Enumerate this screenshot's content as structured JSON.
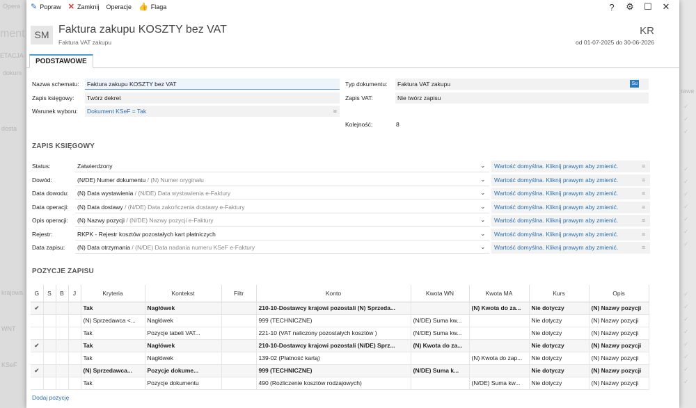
{
  "background": {
    "texts": [
      "Opera",
      "ment",
      "ETACJA",
      "dokum",
      "dosta",
      "krajowa",
      "WNT",
      "KSeF",
      "rawe"
    ]
  },
  "toolbar": {
    "edit_label": "Popraw",
    "close_label": "Zamknij",
    "operations_label": "Operacje",
    "flag_label": "Flaga"
  },
  "header": {
    "avatar": "SM",
    "title": "Faktura zakupu KOSZTY bez VAT",
    "subtitle": "Faktura VAT zakupu",
    "code": "KR",
    "date_range": "od 01-07-2025 do 30-06-2026"
  },
  "tabs": [
    {
      "label": "PODSTAWOWE"
    }
  ],
  "basic": {
    "schema_name_label": "Nazwa schematu:",
    "schema_name_value": "Faktura zakupu KOSZTY bez VAT",
    "ledger_entry_label": "Zapis księgowy:",
    "ledger_entry_value": "Twórz dekret",
    "condition_label": "Warunek wyboru:",
    "condition_value": "Dokument KSeF = Tak",
    "doc_type_label": "Typ dokumentu:",
    "doc_type_value": "Faktura VAT zakupu",
    "doc_type_badge": "Su",
    "vat_entry_label": "Zapis VAT:",
    "vat_entry_value": "Nie twórz zapisu",
    "order_label": "Kolejność:",
    "order_value": "8"
  },
  "sections": {
    "ledger": "ZAPIS KSIĘGOWY",
    "positions": "POZYCJE ZAPISU"
  },
  "default_hint": "Wartość domyślna. Kliknij prawym aby zmienić.",
  "ledger_fields": [
    {
      "label": "Status:",
      "value": "Zatwierdzony",
      "secondary": ""
    },
    {
      "label": "Dowód:",
      "value": "(N/DE) Numer dokumentu",
      "secondary": " / (N) Numer oryginału"
    },
    {
      "label": "Data dowodu:",
      "value": "(N) Data wystawienia",
      "secondary": " / (N/DE) Data wystawienia e-Faktury"
    },
    {
      "label": "Data operacji:",
      "value": "(N) Data dostawy",
      "secondary": " / (N/DE) Data zakończenia dostawy e-Faktury"
    },
    {
      "label": "Opis operacji:",
      "value": "(N) Nazwy pozycji",
      "secondary": " / (N/DE) Nazwy pozycji e-Faktury"
    },
    {
      "label": "Rejestr:",
      "value": "RKPK - Rejestr kosztów pozostałych kart płatniczych",
      "secondary": ""
    },
    {
      "label": "Data zapisu:",
      "value": "(N) Data otrzymania",
      "secondary": " / (N/DE) Data nadania numeru KSeF e-Faktury"
    }
  ],
  "grid": {
    "columns": [
      "G",
      "S",
      "B",
      "J",
      "Kryteria",
      "Kontekst",
      "Filtr",
      "Konto",
      "Kwota WN",
      "Kwota MA",
      "Kurs",
      "Opis"
    ],
    "rows": [
      {
        "bold": true,
        "g": "✔",
        "kryteria": "Tak",
        "kontekst": "Nagłówek",
        "filtr": "",
        "konto": "210-10-Dostawcy krajowi pozostali (N) Sprzeda...",
        "wn": "",
        "ma": "(N) Kwota do za...",
        "kurs": "Nie dotyczy",
        "opis": "(N) Nazwy pozycji"
      },
      {
        "bold": false,
        "g": "",
        "kryteria": "(N) Sprzedawca <...",
        "kontekst": "Nagłówek",
        "filtr": "",
        "konto": "999 (TECHNICZNE)",
        "wn": "(N/DE) Suma kw...",
        "ma": "",
        "kurs": "Nie dotyczy",
        "opis": "(N) Nazwy pozycji"
      },
      {
        "bold": false,
        "g": "",
        "kryteria": "Tak",
        "kontekst": "Pozycje tabeli VAT...",
        "filtr": "",
        "konto": "221-10 (VAT naliczony pozostałych kosztów )",
        "wn": "(N/DE) Suma kw...",
        "ma": "",
        "kurs": "Nie dotyczy",
        "opis": "(N) Nazwy pozycji"
      },
      {
        "bold": true,
        "g": "✔",
        "kryteria": "Tak",
        "kontekst": "Nagłówek",
        "filtr": "",
        "konto": "210-10-Dostawcy krajowi pozostali (N/DE) Sprz...",
        "wn": "(N) Kwota do za...",
        "ma": "",
        "kurs": "Nie dotyczy",
        "opis": "(N) Nazwy pozycji"
      },
      {
        "bold": false,
        "g": "",
        "kryteria": "Tak",
        "kontekst": "Nagłówek",
        "filtr": "",
        "konto": "139-02 (Płatność kartą)",
        "wn": "",
        "ma": "(N) Kwota do zap...",
        "kurs": "Nie dotyczy",
        "opis": "(N) Nazwy pozycji"
      },
      {
        "bold": true,
        "g": "✔",
        "kryteria": "(N) Sprzedawca...",
        "kontekst": "Pozycje dokume...",
        "filtr": "",
        "konto": "999 (TECHNICZNE)",
        "wn": "(N/DE) Suma k...",
        "ma": "",
        "kurs": "Nie dotyczy",
        "opis": "(N) Nazwy pozycji"
      },
      {
        "bold": false,
        "g": "",
        "kryteria": "Tak",
        "kontekst": "Pozycje dokumentu",
        "filtr": "",
        "konto": "490 (Rozliczenie kosztów rodzajowych)",
        "wn": "",
        "ma": "(N/DE) Suma kw...",
        "kurs": "Nie dotyczy",
        "opis": "(N) Nazwy pozycji"
      }
    ]
  },
  "add_position": "Dodaj pozycję"
}
